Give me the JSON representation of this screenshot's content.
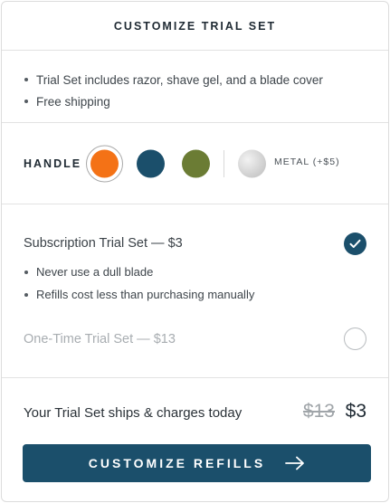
{
  "header": {
    "title": "CUSTOMIZE TRIAL SET"
  },
  "includes": {
    "items": [
      "Trial Set includes razor, shave gel, and a blade cover",
      "Free shipping"
    ]
  },
  "handle": {
    "label": "HANDLE",
    "swatches": [
      {
        "name": "orange",
        "color": "#f47216",
        "selected": true
      },
      {
        "name": "navy",
        "color": "#1b4f6b",
        "selected": false
      },
      {
        "name": "olive",
        "color": "#6b7c34",
        "selected": false
      },
      {
        "name": "metal",
        "color": "#d4d4d4",
        "selected": false
      }
    ],
    "metal_label": "METAL (+$5)"
  },
  "plans": [
    {
      "title": "Subscription Trial Set — $3",
      "selected": true,
      "bullets": [
        "Never use a dull blade",
        "Refills cost less than purchasing manually"
      ]
    },
    {
      "title": "One-Time Trial Set — $13",
      "selected": false
    }
  ],
  "total": {
    "text": "Your Trial Set ships & charges today",
    "old_price": "$13",
    "new_price": "$3"
  },
  "cta": {
    "label": "CUSTOMIZE REFILLS",
    "icon": "arrow-right-icon"
  },
  "colors": {
    "brand": "#1b4f6b",
    "accent": "#f47216"
  }
}
